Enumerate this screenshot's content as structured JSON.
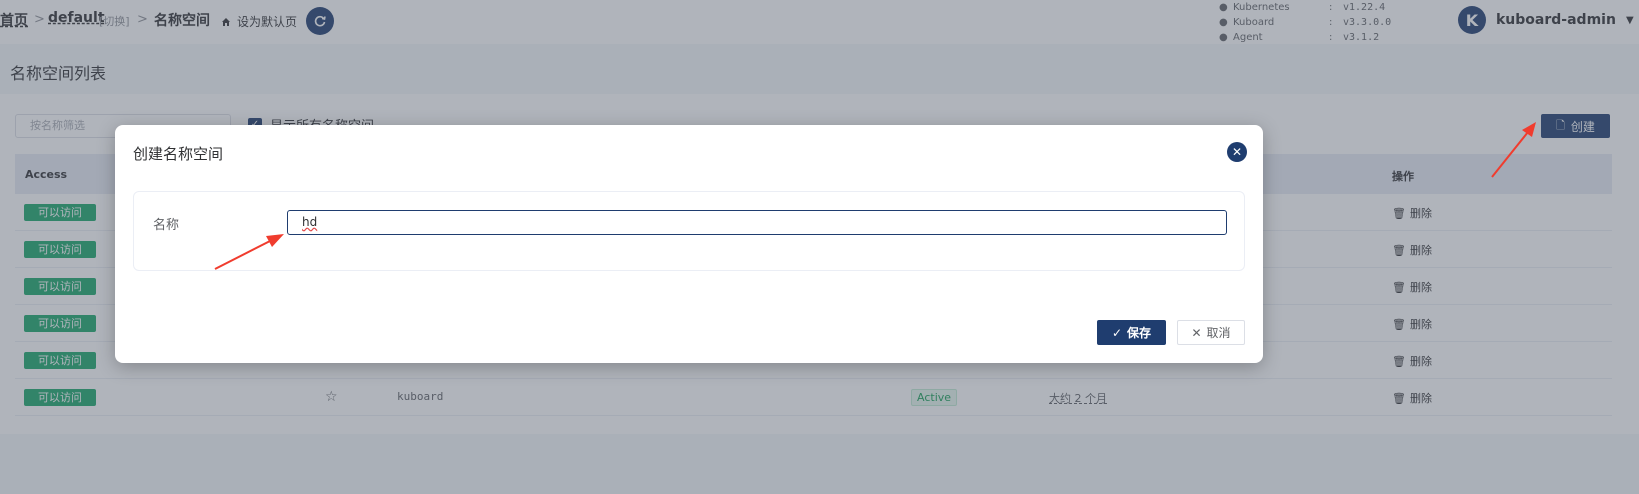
{
  "topbar": {
    "home": "首页",
    "cluster": "default",
    "switch": "[切换]",
    "current": "名称空间",
    "set_default": "设为默认页",
    "versions": [
      {
        "name": "Kubernetes",
        "value": "v1.22.4"
      },
      {
        "name": "Kuboard",
        "value": "v3.3.0.0"
      },
      {
        "name": "Agent",
        "value": "v3.1.2"
      }
    ],
    "avatar_letter": "K",
    "username": "kuboard-admin"
  },
  "page": {
    "title": "名称空间列表",
    "filter_placeholder": "按名称筛选",
    "show_all_label": "显示所有名称空间",
    "create_label": "创建"
  },
  "table": {
    "col_access": "Access",
    "col_ops": "操作",
    "rows": [
      {
        "access": "可以访问",
        "name": "",
        "status": "",
        "age": "",
        "op": "删除"
      },
      {
        "access": "可以访问",
        "name": "",
        "status": "",
        "age": "",
        "op": "删除"
      },
      {
        "access": "可以访问",
        "name": "",
        "status": "",
        "age": "",
        "op": "删除"
      },
      {
        "access": "可以访问",
        "name": "",
        "status": "",
        "age": "",
        "op": "删除"
      },
      {
        "access": "可以访问",
        "name": "",
        "status": "",
        "age": "",
        "op": "删除"
      },
      {
        "access": "可以访问",
        "name": "kuboard",
        "status": "Active",
        "age": "大约 2 个月",
        "op": "删除"
      }
    ]
  },
  "modal": {
    "title": "创建名称空间",
    "name_label": "名称",
    "name_value": "hd",
    "save_label": "保存",
    "cancel_label": "取消"
  },
  "colors": {
    "primary": "#1f3d6f",
    "success": "#1aa86b",
    "annotation": "#f03c2e"
  }
}
